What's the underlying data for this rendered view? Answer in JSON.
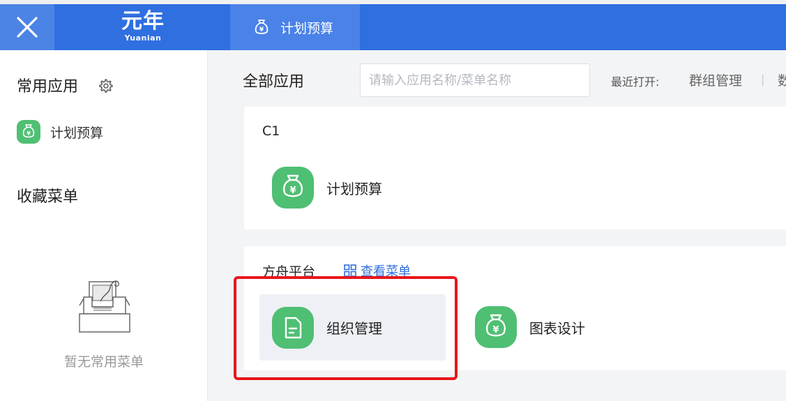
{
  "header": {
    "logo_main": "元年",
    "logo_sub": "Yuanian",
    "active_tab": "计划预算"
  },
  "sidebar": {
    "frequent_heading": "常用应用",
    "frequent_items": [
      {
        "label": "计划预算",
        "icon": "money-bag-icon"
      }
    ],
    "favorites_heading": "收藏菜单",
    "empty_text": "暂无常用菜单"
  },
  "main": {
    "title": "全部应用",
    "search_placeholder": "请输入应用名称/菜单名称",
    "recent_label": "最近打开:",
    "recent_items": [
      "群组管理"
    ],
    "recent_more": "数",
    "groups": [
      {
        "name": "C1",
        "apps": [
          {
            "label": "计划预算",
            "icon": "money-bag-icon"
          }
        ]
      },
      {
        "name": "方舟平台",
        "view_menu_label": "查看菜单",
        "apps": [
          {
            "label": "组织管理",
            "icon": "document-icon"
          },
          {
            "label": "图表设计",
            "icon": "money-bag-icon"
          }
        ]
      }
    ]
  },
  "colors": {
    "header_blue": "#2f6fe0",
    "app_green": "#4fbf73",
    "highlight_red": "#e8161b"
  }
}
